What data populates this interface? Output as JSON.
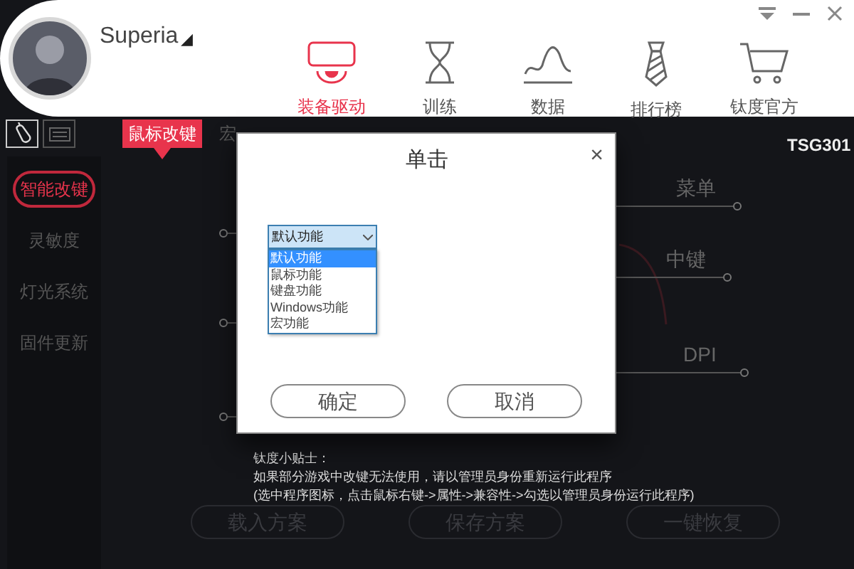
{
  "header": {
    "user": "Superia",
    "user_caret": "◢",
    "nav": [
      {
        "label": "装备驱动",
        "selected": true
      },
      {
        "label": "训练",
        "selected": false
      },
      {
        "label": "数据",
        "selected": false
      },
      {
        "label": "排行榜",
        "selected": false
      },
      {
        "label": "钛度官方",
        "selected": false
      }
    ]
  },
  "device_tabs": [
    {
      "selected": true
    },
    {
      "selected": false
    }
  ],
  "sidebar": [
    {
      "label": "智能改键",
      "selected": true
    },
    {
      "label": "灵敏度",
      "selected": false
    },
    {
      "label": "灯光系统",
      "selected": false
    },
    {
      "label": "固件更新",
      "selected": false
    }
  ],
  "mode_tabs": [
    {
      "label": "鼠标改键",
      "selected": true
    },
    {
      "label": "宏",
      "selected": false
    }
  ],
  "model": "TSG301",
  "button_labels": [
    "菜单",
    "中键",
    "DPI"
  ],
  "dialog": {
    "title": "单击",
    "close": "×",
    "select_value": "默认功能",
    "options": [
      {
        "label": "默认功能",
        "selected": true
      },
      {
        "label": "鼠标功能",
        "selected": false
      },
      {
        "label": "键盘功能",
        "selected": false
      },
      {
        "label": "Windows功能",
        "selected": false
      },
      {
        "label": "宏功能",
        "selected": false
      }
    ],
    "buttons": [
      "确定",
      "取消"
    ]
  },
  "tips": [
    "钛度小贴士：",
    "如果部分游戏中改键无法使用，请以管理员身份重新运行此程序",
    "(选中程序图标，点击鼠标右键->属性->兼容性->勾选以管理员身份运行此程序)"
  ],
  "bottom_buttons": [
    "载入方案",
    "保存方案",
    "一键恢复"
  ]
}
